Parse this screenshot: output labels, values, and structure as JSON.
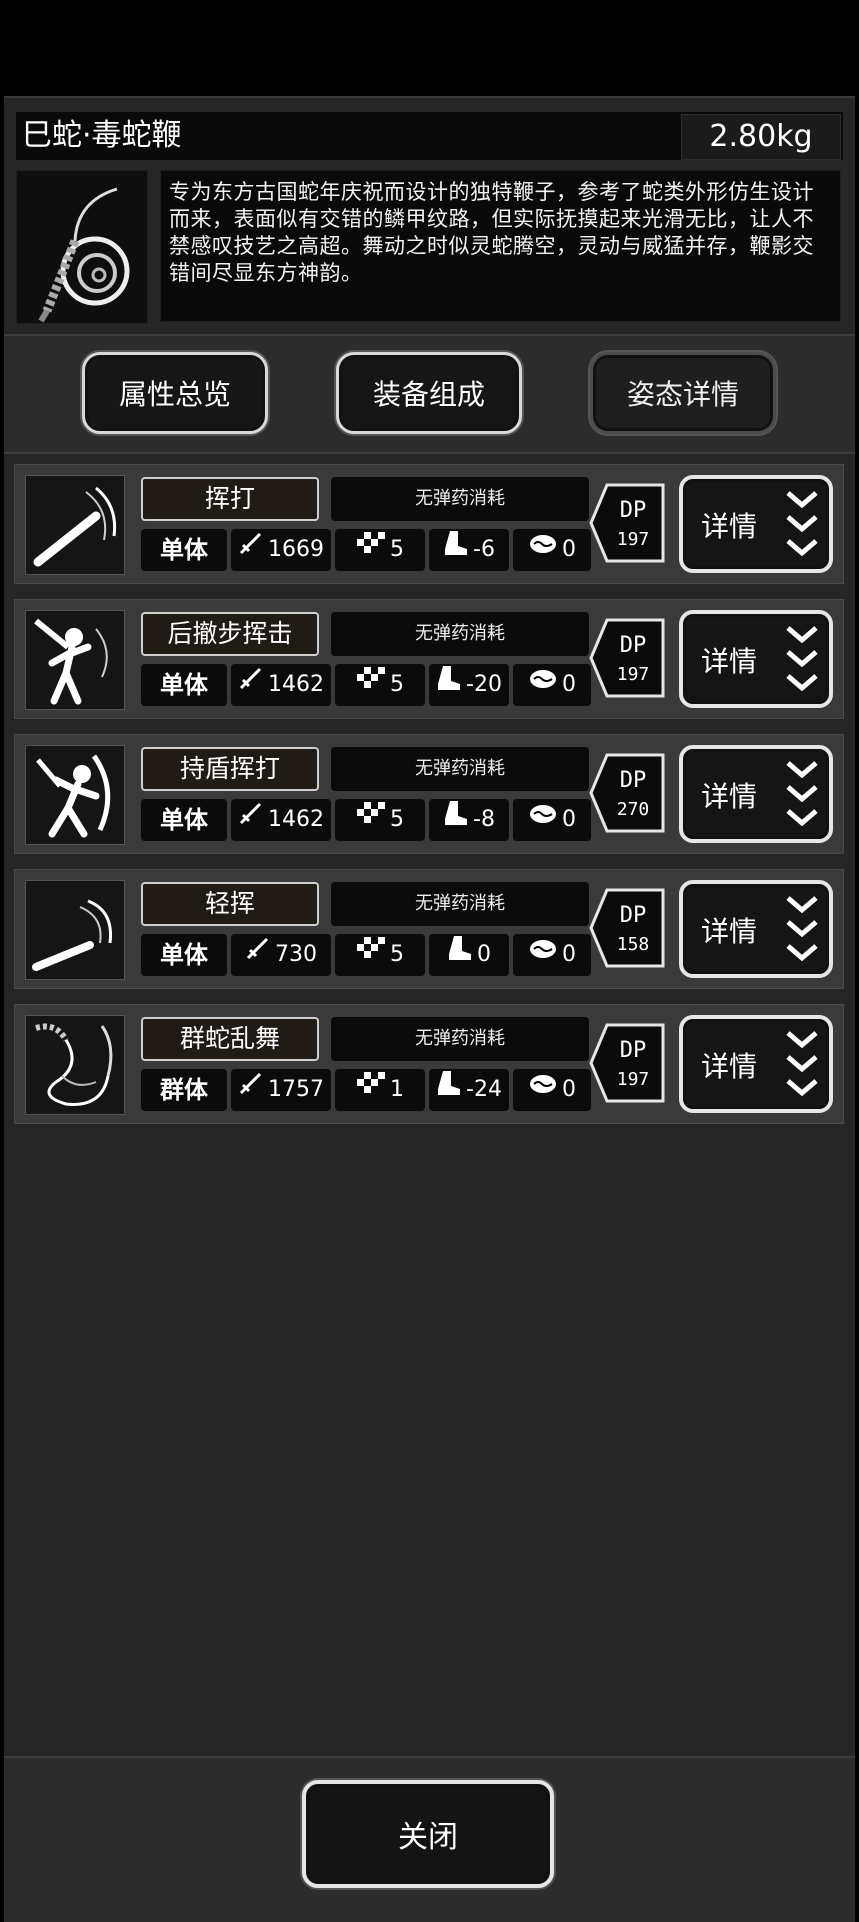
{
  "item": {
    "title": "巳蛇·毒蛇鞭",
    "weight": "2.80kg",
    "icon": "whip-icon",
    "description": "专为东方古国蛇年庆祝而设计的独特鞭子，参考了蛇类外形仿生设计而来，表面似有交错的鳞甲纹路，但实际抚摸起来光滑无比，让人不禁感叹技艺之高超。舞动之时似灵蛇腾空，灵动与威猛并存，鞭影交错间尽显东方神韵。"
  },
  "tabs": [
    {
      "label": "属性总览",
      "active": false
    },
    {
      "label": "装备组成",
      "active": false
    },
    {
      "label": "姿态详情",
      "active": true
    }
  ],
  "moves": [
    {
      "name": "挥打",
      "ammo": "无弹药消耗",
      "target": "单体",
      "attack": "1669",
      "speed": "5",
      "foot": "-6",
      "brain": "0",
      "dp_label": "DP",
      "dp_value": "197",
      "detail_label": "详情",
      "icon": "swing-strike-icon"
    },
    {
      "name": "后撤步挥击",
      "ammo": "无弹药消耗",
      "target": "单体",
      "attack": "1462",
      "speed": "5",
      "foot": "-20",
      "brain": "0",
      "dp_label": "DP",
      "dp_value": "197",
      "detail_label": "详情",
      "icon": "backstep-swing-icon"
    },
    {
      "name": "持盾挥打",
      "ammo": "无弹药消耗",
      "target": "单体",
      "attack": "1462",
      "speed": "5",
      "foot": "-8",
      "brain": "0",
      "dp_label": "DP",
      "dp_value": "270",
      "detail_label": "详情",
      "icon": "shield-swing-icon"
    },
    {
      "name": "轻挥",
      "ammo": "无弹药消耗",
      "target": "单体",
      "attack": "730",
      "speed": "5",
      "foot": "0",
      "brain": "0",
      "dp_label": "DP",
      "dp_value": "158",
      "detail_label": "详情",
      "icon": "light-swing-icon"
    },
    {
      "name": "群蛇乱舞",
      "ammo": "无弹药消耗",
      "target": "群体",
      "attack": "1757",
      "speed": "1",
      "foot": "-24",
      "brain": "0",
      "dp_label": "DP",
      "dp_value": "197",
      "detail_label": "详情",
      "icon": "snake-dance-icon"
    }
  ],
  "close_label": "关闭"
}
